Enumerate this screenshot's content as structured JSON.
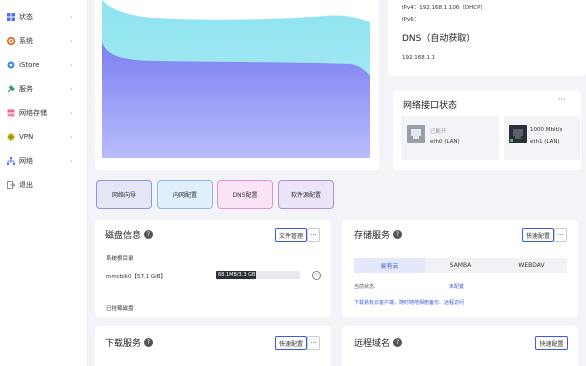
{
  "sidebar": {
    "items": [
      {
        "label": "状态",
        "icon": "status-icon"
      },
      {
        "label": "系统",
        "icon": "gear-icon"
      },
      {
        "label": "iStore",
        "icon": "store-icon"
      },
      {
        "label": "服务",
        "icon": "service-icon"
      },
      {
        "label": "网络存储",
        "icon": "storage-icon"
      },
      {
        "label": "VPN",
        "icon": "vpn-icon"
      },
      {
        "label": "网络",
        "icon": "network-icon"
      },
      {
        "label": "退出",
        "icon": "logout-icon"
      }
    ]
  },
  "net_info": {
    "ipv4": "IPv4：192.168.1.106（DHCP）",
    "ipv6": "IPv6：",
    "dns_title": "DNS（自动获取）",
    "dns_value": "192.168.1.1"
  },
  "interfaces": {
    "title": "网络接口状态",
    "items": [
      {
        "status": "已断开",
        "name": "eth0 (LAN)"
      },
      {
        "status": "1000 Mbit/s",
        "name": "eth1 (LAN)"
      }
    ]
  },
  "quick_buttons": [
    "网络向导",
    "内网配置",
    "DNS配置",
    "软件源配置"
  ],
  "disk": {
    "title": "磁盘信息",
    "manage_label": "文件管理",
    "system_label": "系统根目录",
    "device": "mmcblk0【57.1 GiB】",
    "usage": "68.1MB/3.3 GB",
    "usage_fraction": 0.48,
    "mounted_label": "已挂载磁盘"
  },
  "storage": {
    "title": "存储服务",
    "config_label": "快速配置",
    "tabs": [
      "易有云",
      "SAMBA",
      "WEBDAV"
    ],
    "status_label": "当前状态:",
    "status_value": "未配置",
    "link": "下载易有云客户端，随时随地相册备份、远程访问"
  },
  "download": {
    "title": "下载服务",
    "config_label": "快速配置"
  },
  "remote": {
    "title": "远程域名",
    "config_label": "快速配置"
  },
  "colors": {
    "accent": "#3b5bdb",
    "chart_top": "#8de3f0",
    "chart_bottom": "#7b7ff0"
  }
}
